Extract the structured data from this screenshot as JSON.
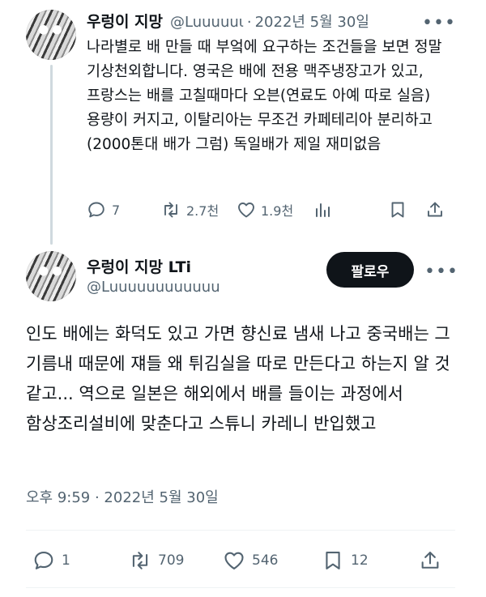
{
  "reply_tweet": {
    "author_name": "우렁이 지망",
    "handle": "@Luuuuuι",
    "separator": "·",
    "date": "2022년 5월 30일",
    "more": "•••",
    "text": "나라별로 배 만들 때 부엌에 요구하는 조건들을 보면 정말 기상천외합니다. 영국은 배에 전용 맥주냉장고가 있고, 프랑스는 배를 고칠때마다 오븐(연료도 아예 따로 실음) 용량이 커지고, 이탈리아는 무조건 카페테리아 분리하고 (2000톤대 배가 그럼) 독일배가 제일 재미없음",
    "replies": "7",
    "reposts": "2.7천",
    "likes": "1.9천"
  },
  "main_tweet": {
    "author_name": "우렁이 지망 LTi",
    "handle": "@Luuuuuuuuuuuu",
    "follow_label": "팔로우",
    "more": "•••",
    "text": "인도 배에는 화덕도 있고 가면 향신료 냄새 나고 중국배는 그 기름내 때문에 쟤들 왜 튀김실을 따로 만든다고 하는지 알 것 같고... 역으로 일본은 해외에서 배를 들이는 과정에서 함상조리설비에 맞춘다고 스튜니 카레니 반입했고",
    "timestamp": "오후 9:59 · 2022년 5월 30일",
    "replies": "1",
    "reposts": "709",
    "likes": "546",
    "bookmarks": "12"
  },
  "icons": {
    "reply": "reply-icon",
    "repost": "repost-icon",
    "like": "heart-icon",
    "views": "views-icon",
    "bookmark": "bookmark-icon",
    "share": "share-icon"
  }
}
